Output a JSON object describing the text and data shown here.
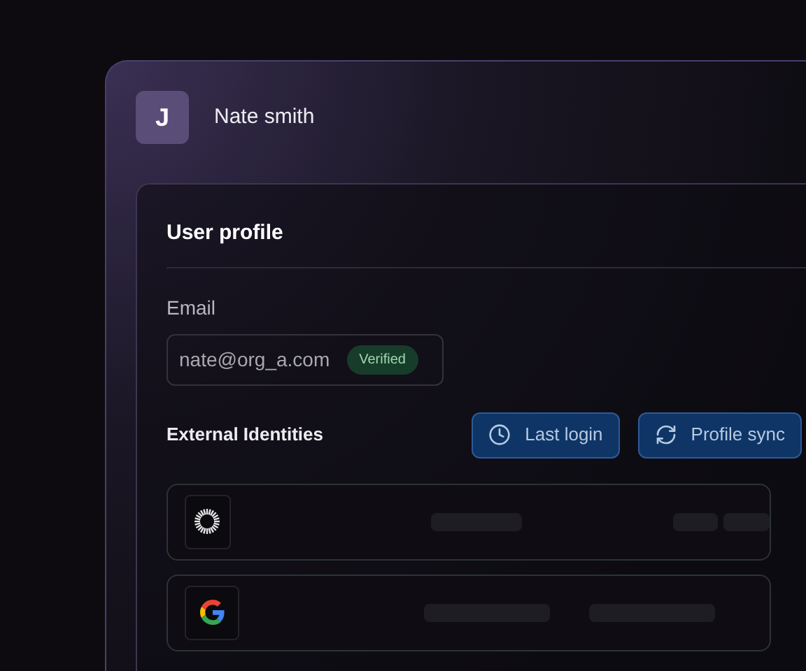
{
  "user": {
    "initial": "J",
    "name": "Nate smith"
  },
  "profile": {
    "title": "User profile",
    "email_label": "Email",
    "email": "nate@org_a.com",
    "email_badge": "Verified"
  },
  "identities": {
    "title": "External Identities",
    "buttons": [
      {
        "label": "Last login",
        "kind": "clock"
      },
      {
        "label": "Profile sync",
        "kind": "sync"
      }
    ],
    "rows": [
      {
        "kind": "sunburst"
      },
      {
        "kind": "google"
      }
    ]
  }
}
